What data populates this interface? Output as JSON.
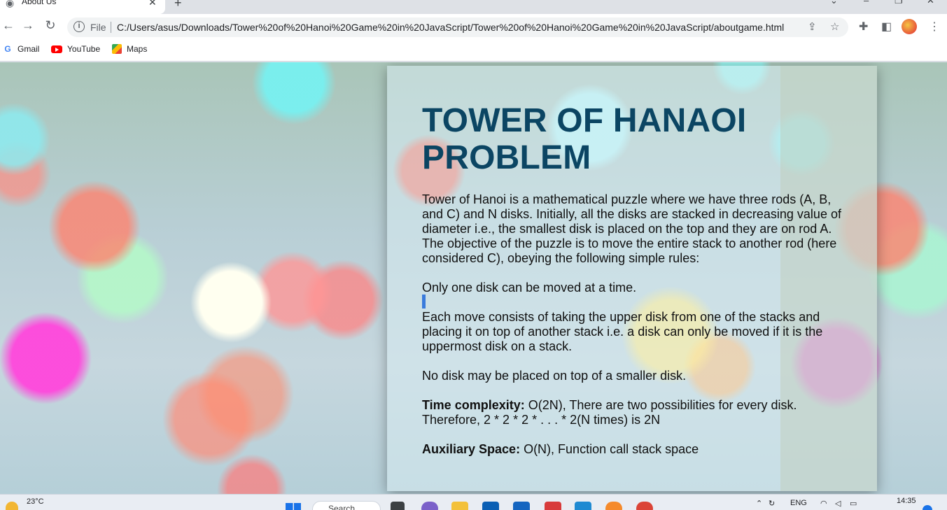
{
  "browser": {
    "tab_title": "About Us",
    "url_scheme": "File",
    "url": "C:/Users/asus/Downloads/Tower%20of%20Hanoi%20Game%20in%20JavaScript/Tower%20of%20Hanoi%20Game%20in%20JavaScript/aboutgame.html",
    "bookmarks": [
      "Gmail",
      "YouTube",
      "Maps"
    ]
  },
  "page": {
    "heading": "TOWER OF HANAOI PROBLEM",
    "intro": "Tower of Hanoi is a mathematical puzzle where we have three rods (A, B, and C) and N disks. Initially, all the disks are stacked in decreasing value of diameter i.e., the smallest disk is placed on the top and they are on rod A. The objective of the puzzle is to move the entire stack to another rod (here considered C), obeying the following simple rules:",
    "rule1": "Only one disk can be moved at a time.",
    "rule2": "Each move consists of taking the upper disk from one of the stacks and placing it on top of another stack i.e. a disk can only be moved if it is the uppermost disk on a stack.",
    "rule3": "No disk may be placed on top of a smaller disk.",
    "time_label": "Time complexity:",
    "time_text": " O(2N), There are two possibilities for every disk. Therefore, 2 * 2 * 2 * . . . * 2(N times) is 2N",
    "space_label": "Auxiliary Space:",
    "space_text": " O(N), Function call stack space"
  },
  "taskbar": {
    "temperature": "23°C",
    "search_placeholder": "Search",
    "language": "ENG",
    "time": "14:35"
  }
}
